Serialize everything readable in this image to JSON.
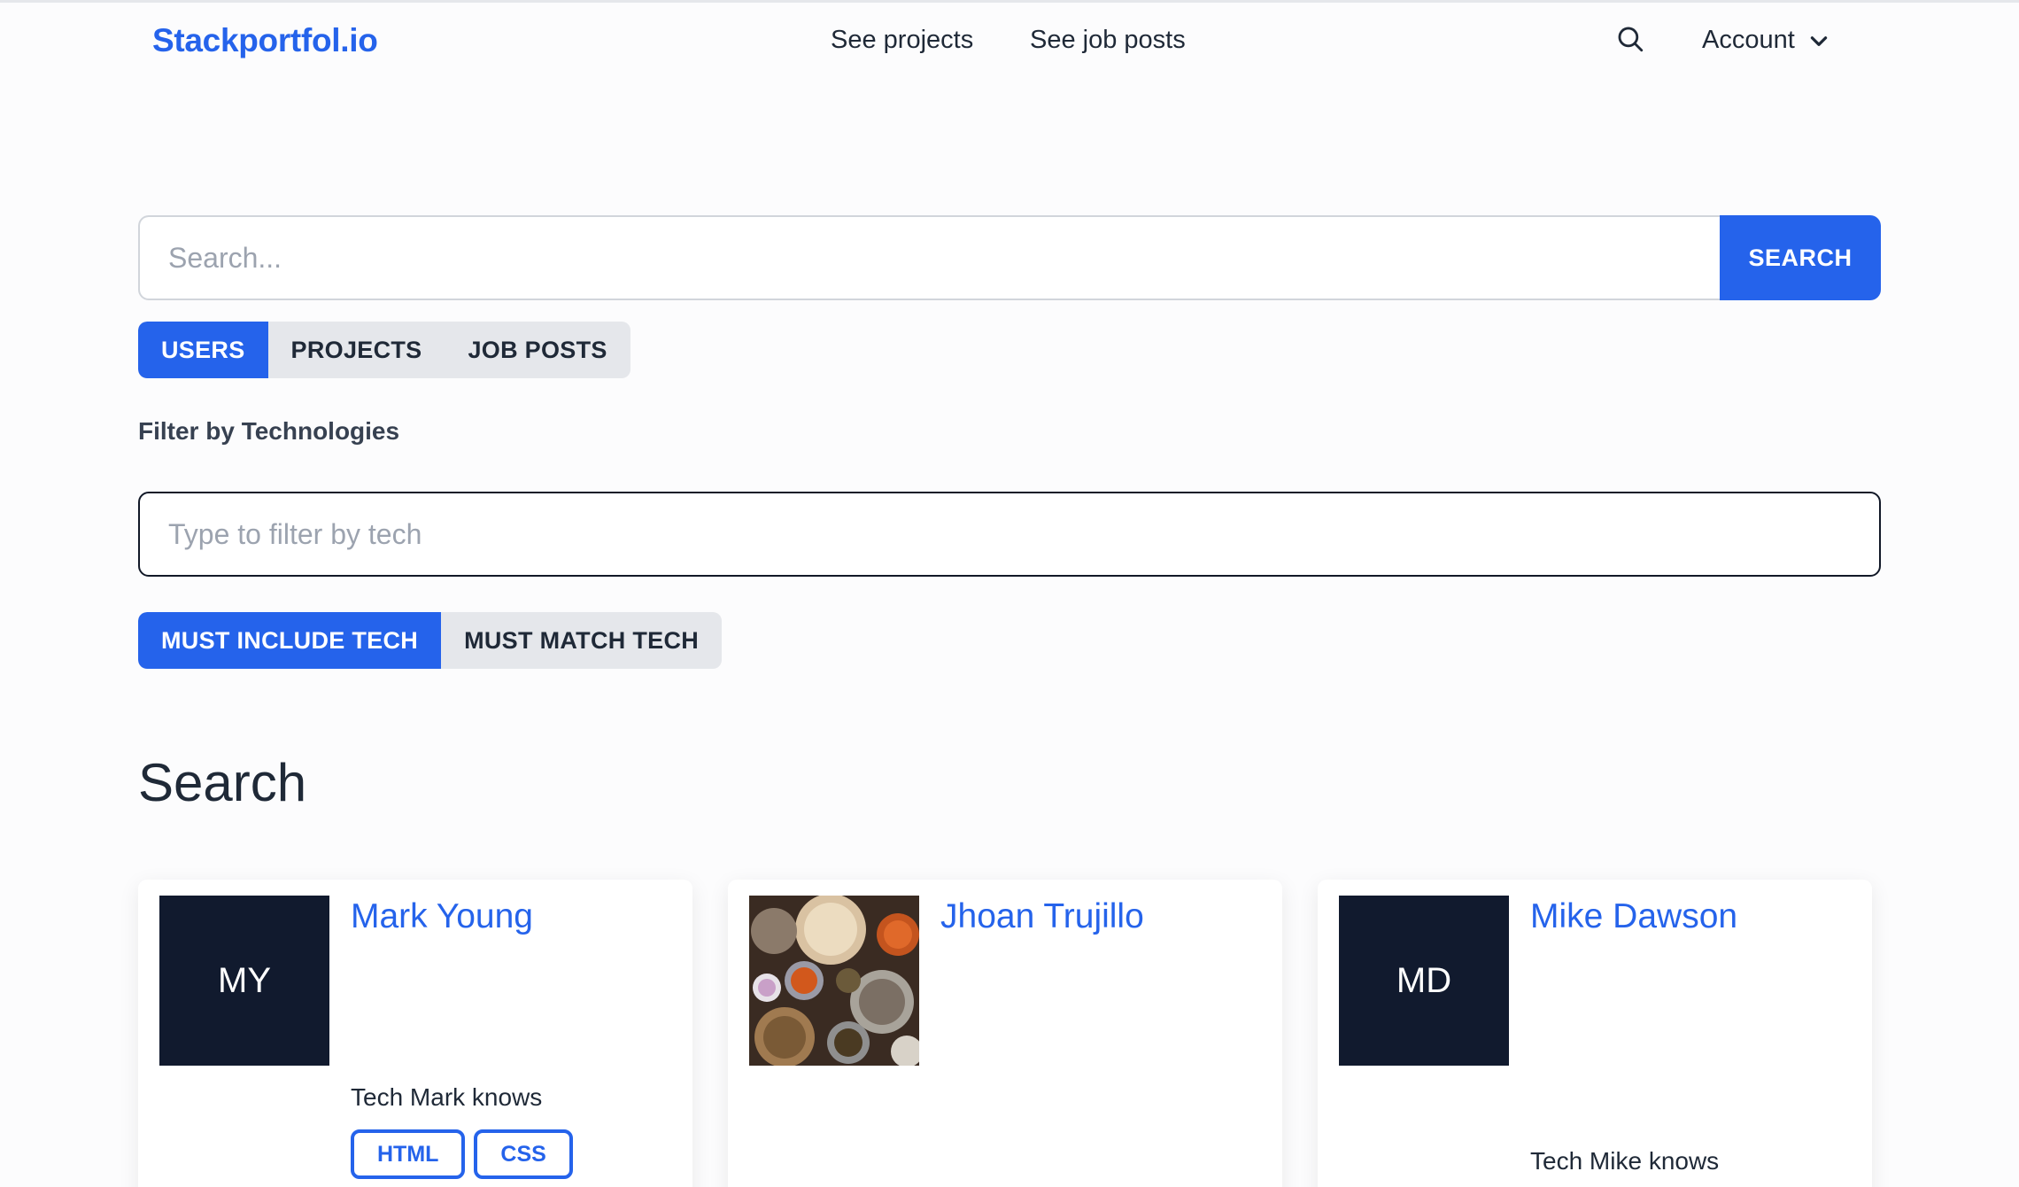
{
  "nav": {
    "brand": "Stackportfol.io",
    "links": [
      "See projects",
      "See job posts"
    ],
    "account": "Account"
  },
  "search": {
    "placeholder": "Search...",
    "button": "SEARCH"
  },
  "tabs": [
    {
      "label": "USERS",
      "active": true
    },
    {
      "label": "PROJECTS",
      "active": false
    },
    {
      "label": "JOB POSTS",
      "active": false
    }
  ],
  "filter": {
    "label": "Filter by Technologies",
    "placeholder": "Type to filter by tech"
  },
  "match": [
    {
      "label": "MUST INCLUDE TECH",
      "active": true
    },
    {
      "label": "MUST MATCH TECH",
      "active": false
    }
  ],
  "section_title": "Search",
  "colors": {
    "accent": "#2563eb",
    "avatar_bg": "#111a2e"
  },
  "cards": [
    {
      "name": "Mark Young",
      "initials": "MY",
      "knows": "Tech Mark knows",
      "tags": [
        "HTML",
        "CSS"
      ]
    },
    {
      "name": "Jhoan Trujillo",
      "has_photo": true
    },
    {
      "name": "Mike Dawson",
      "initials": "MD",
      "knows": "Tech Mike knows"
    }
  ]
}
